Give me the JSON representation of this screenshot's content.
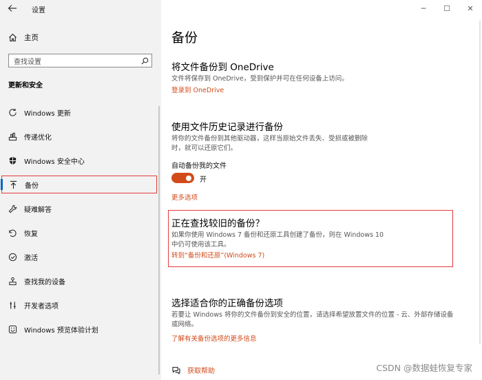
{
  "window": {
    "title": "设置",
    "controls": {
      "minimize": "─",
      "maximize": "☐",
      "close": "✕"
    }
  },
  "sidebar": {
    "home_label": "主页",
    "search_placeholder": "查找设置",
    "section_title": "更新和安全",
    "items": [
      {
        "label": "Windows 更新",
        "icon": "refresh-icon"
      },
      {
        "label": "传递优化",
        "icon": "delivery-optimization-icon"
      },
      {
        "label": "Windows 安全中心",
        "icon": "shield-icon"
      },
      {
        "label": "备份",
        "icon": "backup-arrow-icon",
        "active": true
      },
      {
        "label": "疑难解答",
        "icon": "wrench-icon"
      },
      {
        "label": "恢复",
        "icon": "recovery-icon"
      },
      {
        "label": "激活",
        "icon": "check-circle-icon"
      },
      {
        "label": "查找我的设备",
        "icon": "find-device-icon"
      },
      {
        "label": "开发者选项",
        "icon": "developer-icon"
      },
      {
        "label": "Windows 预览体验计划",
        "icon": "insider-icon"
      }
    ]
  },
  "main": {
    "page_title": "备份",
    "onedrive": {
      "title": "将文件备份到 OneDrive",
      "description": "文件将保存到 OneDrive，受到保护并可在任何设备上访问。",
      "link": "登录到 OneDrive"
    },
    "file_history": {
      "title": "使用文件历史记录进行备份",
      "description_line1": "将你的文件备份到其他驱动器，这样当原始文件丢失、受损或被删除",
      "description_line2": "时，就可以还原它们。",
      "toggle_label": "自动备份我的文件",
      "toggle_state": "开",
      "toggle_on": true,
      "more_options": "更多选项"
    },
    "older_backup": {
      "title": "正在查找较旧的备份？",
      "description_line1": "如果你使用 Windows 7 备份和还原工具创建了备份，则在 Windows 10",
      "description_line2": "中仍可使用该工具。",
      "link": "转到“备份和还原”(Windows 7)"
    },
    "right_option": {
      "title": "选择适合你的正确备份选项",
      "description_line1": "若要让 Windows 将你的文件备份到安全的位置，请选择希望放置文件的位置 - 云、外部存储设备",
      "description_line2": "或网络。",
      "link": "了解有关备份选项的更多信息"
    },
    "help_link": "获取帮助"
  },
  "watermark": "CSDN @数据蛙恢复专家",
  "colors": {
    "accent": "#d24b1a",
    "highlight_border": "#e23a3a",
    "sidebar_bg": "#f2f2f2"
  }
}
